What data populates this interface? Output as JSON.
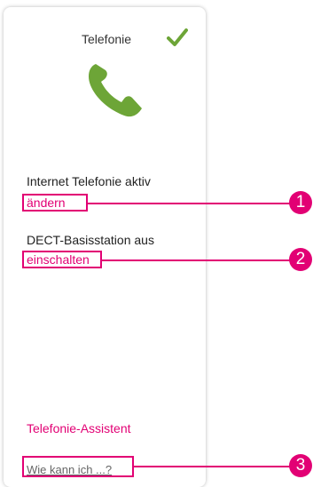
{
  "card": {
    "title": "Telefonie",
    "status_icon": "checkmark-icon",
    "main_icon": "telephone-handset-icon",
    "accent_color": "#e20074",
    "success_color": "#6da537",
    "internet": {
      "status": "Internet Telefonie aktiv",
      "action": "ändern"
    },
    "dect": {
      "status": "DECT-Basisstation aus",
      "action": "einschalten"
    },
    "assistant_link": "Telefonie-Assistent",
    "help_link": "Wie kann ich ...?"
  },
  "callouts": [
    "1",
    "2",
    "3"
  ]
}
